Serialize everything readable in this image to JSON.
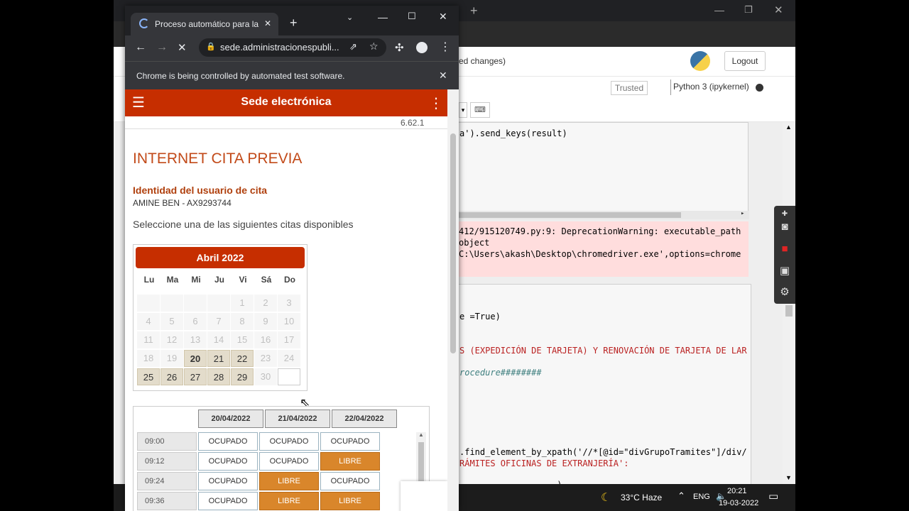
{
  "bg_browser": {
    "jupyter": {
      "header_text": "ed changes)",
      "logout_label": "Logout",
      "trusted_label": "Trusted",
      "kernel_label": "Python 3 (ipykernel)"
    },
    "code": {
      "line1": "a').send_keys(result)",
      "stderr_line1": "412/915120749.py:9: DeprecationWarning: executable_path",
      "stderr_line2": "object",
      "stderr_line3": "C:\\Users\\akash\\Desktop\\chromedriver.exe',options=chrome",
      "line_true": "e =True)",
      "line_expedicion": "S (EXPEDICIÓN DE TARJETA) Y RENOVACIÓN DE TARJETA DE LAR",
      "line_procedure": "rocedure########",
      "line_find": ".find_element_by_xpath('//*[@id=\"divGrupoTramites\"]/div/",
      "line_tramites": "RÁMITES OFICINAS DE EXTRANJERÍA':",
      "line_partial": "                   )"
    },
    "taskbar": {
      "weather": "33°C Haze",
      "lang": "ENG",
      "time": "20:21",
      "date": "19-03-2022"
    }
  },
  "chrome": {
    "tab_title": "Proceso automático para la s…",
    "new_tab_label": "+",
    "url": "sede.administracionespubli...",
    "infobar_text": "Chrome is being controlled by automated test software.",
    "icons": {
      "back": "back-icon",
      "forward": "forward-icon",
      "stop": "stop-icon",
      "lock": "lock-icon",
      "share": "share-icon",
      "star": "star-icon",
      "extensions": "puzzle-icon",
      "profile": "profile-icon",
      "menu": "kebab-menu-icon"
    }
  },
  "site": {
    "header_title": "Sede electrónica",
    "version": "6.62.1",
    "page_title": "INTERNET CITA PREVIA",
    "identity_label": "Identidad del usuario de cita",
    "identity_value": "AMINE BEN - AX9293744",
    "instruction": "Seleccione una de las siguientes citas disponibles",
    "accent_color": "#c62e00"
  },
  "calendar": {
    "month_label": "Abril 2022",
    "weekdays": [
      "Lu",
      "Ma",
      "Mi",
      "Ju",
      "Vi",
      "Sá",
      "Do"
    ],
    "weeks": [
      [
        {
          "d": "",
          "s": "empty"
        },
        {
          "d": "",
          "s": "empty"
        },
        {
          "d": "",
          "s": "empty"
        },
        {
          "d": "",
          "s": "empty"
        },
        {
          "d": "1",
          "s": "disabled"
        },
        {
          "d": "2",
          "s": "weekend"
        },
        {
          "d": "3",
          "s": "weekend"
        }
      ],
      [
        {
          "d": "4",
          "s": "disabled"
        },
        {
          "d": "5",
          "s": "disabled"
        },
        {
          "d": "6",
          "s": "disabled"
        },
        {
          "d": "7",
          "s": "disabled"
        },
        {
          "d": "8",
          "s": "disabled"
        },
        {
          "d": "9",
          "s": "weekend"
        },
        {
          "d": "10",
          "s": "weekend"
        }
      ],
      [
        {
          "d": "11",
          "s": "disabled"
        },
        {
          "d": "12",
          "s": "disabled"
        },
        {
          "d": "13",
          "s": "disabled"
        },
        {
          "d": "14",
          "s": "disabled"
        },
        {
          "d": "15",
          "s": "disabled"
        },
        {
          "d": "16",
          "s": "weekend"
        },
        {
          "d": "17",
          "s": "weekend"
        }
      ],
      [
        {
          "d": "18",
          "s": "disabled"
        },
        {
          "d": "19",
          "s": "disabled"
        },
        {
          "d": "20",
          "s": "selected"
        },
        {
          "d": "21",
          "s": "available"
        },
        {
          "d": "22",
          "s": "available"
        },
        {
          "d": "23",
          "s": "weekend"
        },
        {
          "d": "24",
          "s": "weekend"
        }
      ],
      [
        {
          "d": "25",
          "s": "available"
        },
        {
          "d": "26",
          "s": "available"
        },
        {
          "d": "27",
          "s": "available"
        },
        {
          "d": "28",
          "s": "available"
        },
        {
          "d": "29",
          "s": "available"
        },
        {
          "d": "30",
          "s": "weekend"
        },
        {
          "d": "",
          "s": "blank"
        }
      ]
    ]
  },
  "slots": {
    "dates": [
      "20/04/2022",
      "21/04/2022",
      "22/04/2022"
    ],
    "rows": [
      {
        "time": "09:00",
        "cells": [
          "OCUPADO",
          "OCUPADO",
          "OCUPADO"
        ]
      },
      {
        "time": "09:12",
        "cells": [
          "OCUPADO",
          "OCUPADO",
          "LIBRE"
        ]
      },
      {
        "time": "09:24",
        "cells": [
          "OCUPADO",
          "LIBRE",
          "OCUPADO"
        ]
      },
      {
        "time": "09:36",
        "cells": [
          "OCUPADO",
          "LIBRE",
          "LIBRE"
        ]
      }
    ]
  }
}
